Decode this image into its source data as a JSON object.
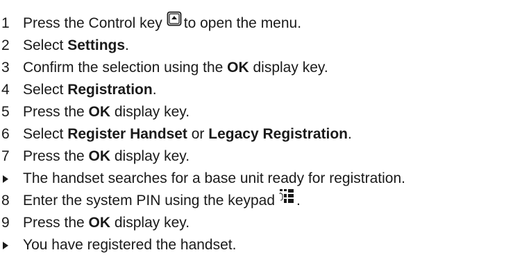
{
  "steps": [
    {
      "marker": "",
      "type": "partial",
      "pre": "",
      "bold": "",
      "post": "",
      "text": "   "
    },
    {
      "marker": "1",
      "pre": "Press the Control key",
      "icon": "control-key-icon",
      "post": "to open the menu."
    },
    {
      "marker": "2",
      "pre": "Select ",
      "bold": "Settings",
      "post": "."
    },
    {
      "marker": "3",
      "pre": "Confirm the selection using the ",
      "bold": "OK",
      "post": " display key."
    },
    {
      "marker": "4",
      "pre": "Select ",
      "bold": "Registration",
      "post": "."
    },
    {
      "marker": "5",
      "pre": "Press the ",
      "bold": "OK",
      "post": " display key."
    },
    {
      "marker": "6",
      "pre": "Select ",
      "bold": "Register Handset",
      "mid": " or ",
      "bold2": "Legacy Registration",
      "post": "."
    },
    {
      "marker": "7",
      "pre": "Press the ",
      "bold": "OK",
      "post": " display key."
    },
    {
      "marker": "result",
      "text": "The handset searches for a base unit ready for registration."
    },
    {
      "marker": "8",
      "pre": "Enter the system PIN using the keypad",
      "icon": "keypad-icon",
      "post": "."
    },
    {
      "marker": "9",
      "pre": "Press the ",
      "bold": "OK",
      "post": " display key."
    },
    {
      "marker": "result",
      "text": "You have registered the handset."
    }
  ],
  "colors": {
    "text": "#1a1a1a",
    "background": "#ffffff"
  }
}
